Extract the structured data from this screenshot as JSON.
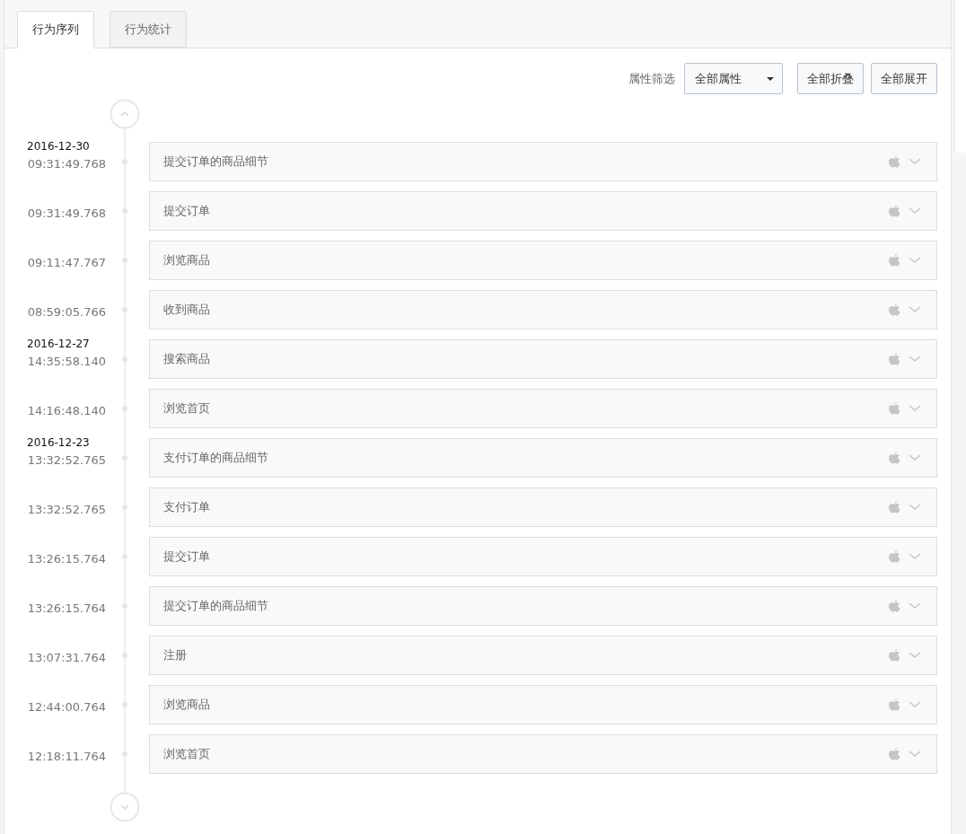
{
  "tabs": [
    {
      "label": "行为序列",
      "selected": true
    },
    {
      "label": "行为统计",
      "selected": false
    }
  ],
  "toolbar": {
    "filter_label": "属性筛选",
    "filter_value": "全部属性",
    "buttons": [
      "全部折叠",
      "全部展开"
    ]
  },
  "days": [
    {
      "date": "2016-12-30",
      "events": [
        {
          "time": "09:31:49.768",
          "name": "提交订单的商品细节"
        },
        {
          "time": "09:31:49.768",
          "name": "提交订单"
        },
        {
          "time": "09:11:47.767",
          "name": "浏览商品"
        },
        {
          "time": "08:59:05.766",
          "name": "收到商品"
        }
      ]
    },
    {
      "date": "2016-12-27",
      "events": [
        {
          "time": "14:35:58.140",
          "name": "搜索商品"
        },
        {
          "time": "14:16:48.140",
          "name": "浏览首页"
        }
      ]
    },
    {
      "date": "2016-12-23",
      "events": [
        {
          "time": "13:32:52.765",
          "name": "支付订单的商品细节"
        },
        {
          "time": "13:32:52.765",
          "name": "支付订单"
        },
        {
          "time": "13:26:15.764",
          "name": "提交订单"
        },
        {
          "time": "13:26:15.764",
          "name": "提交订单的商品细节"
        },
        {
          "time": "13:07:31.764",
          "name": "注册"
        },
        {
          "time": "12:44:00.764",
          "name": "浏览商品"
        },
        {
          "time": "12:18:11.764",
          "name": "浏览首页"
        }
      ]
    }
  ]
}
